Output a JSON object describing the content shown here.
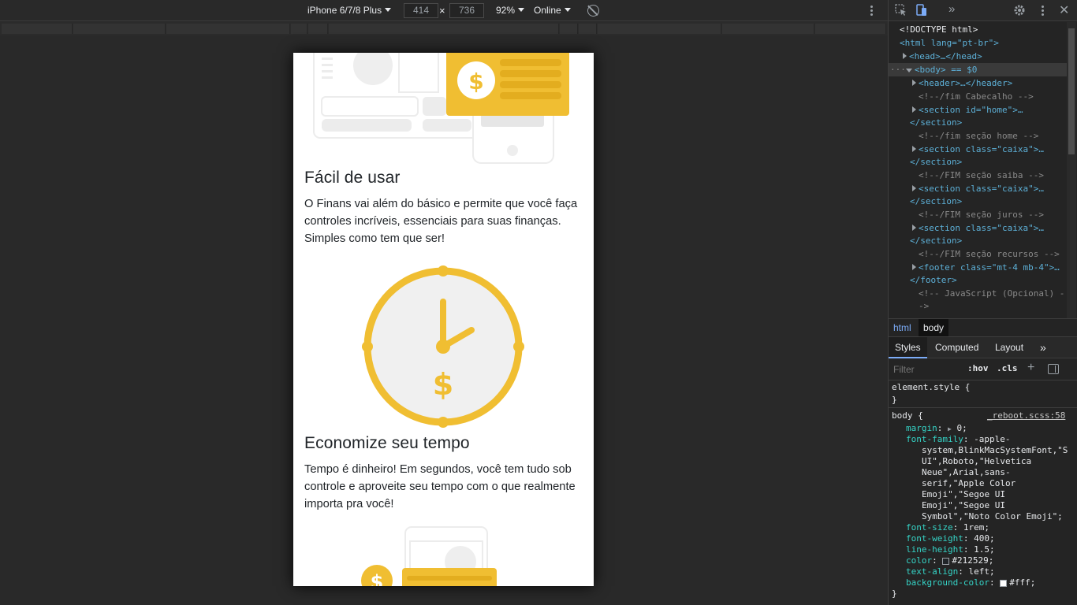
{
  "device_toolbar": {
    "device": "iPhone 6/7/8 Plus",
    "width": "414",
    "times": "×",
    "height": "736",
    "zoom": "92%",
    "throttle": "Online"
  },
  "page": {
    "section1": {
      "title": "Fácil de usar",
      "text": "O Finans vai além do básico e permite que você faça controles incríveis, essenciais para suas finanças. Simples como tem que ser!"
    },
    "section2": {
      "title": "Economize seu tempo",
      "text": "Tempo é dinheiro! Em segundos, você tem tudo sob controle e aproveite seu tempo com o que realmente importa pra você!"
    },
    "dollar_sign": "$"
  },
  "colors": {
    "accent_yellow": "#f0be32",
    "illustration_gray": "#ededed",
    "text_dark": "#212529"
  },
  "devtools": {
    "tree": [
      "<!DOCTYPE html>",
      "<html lang=\"pt-br\">",
      "<head>…</head>",
      "<body> == $0",
      "<header>…</header>",
      "<!--/fim Cabecalho -->",
      "<section id=\"home\">…",
      "</section>",
      "<!--/fim seção home -->",
      "<section class=\"caixa\">…",
      "</section>",
      "<!--/FIM seção saiba -->",
      "<section class=\"caixa\">…",
      "</section>",
      "<!--/FIM seção juros -->",
      "<section class=\"caixa\">…",
      "</section>",
      "<!--/FIM seção recursos -->",
      "<footer class=\"mt-4 mb-4\">…",
      "</footer>",
      "<!-- JavaScript (Opcional) -",
      "->"
    ],
    "breadcrumbs": [
      "html",
      "body"
    ],
    "tabs": [
      "Styles",
      "Computed",
      "Layout"
    ],
    "more_tabs": "»",
    "filter_placeholder": "Filter",
    "hov": ":hov",
    "cls": ".cls",
    "plus": "+",
    "element_style": "element.style {",
    "close_brace": "}",
    "body_rule": "body {",
    "source_link": "_reboot.scss:58",
    "props": [
      {
        "name": "margin",
        "value": "0;"
      },
      {
        "name": "font-family",
        "value": "-apple-"
      },
      {
        "name": "",
        "value": "system,BlinkMacSystemFont,\"S"
      },
      {
        "name": "",
        "value": "UI\",Roboto,\"Helvetica"
      },
      {
        "name": "",
        "value": "Neue\",Arial,sans-"
      },
      {
        "name": "",
        "value": "serif,\"Apple Color"
      },
      {
        "name": "",
        "value": "Emoji\",\"Segoe UI"
      },
      {
        "name": "",
        "value": "Emoji\",\"Segoe UI"
      },
      {
        "name": "",
        "value": "Symbol\",\"Noto Color Emoji\";"
      },
      {
        "name": "font-size",
        "value": "1rem;"
      },
      {
        "name": "font-weight",
        "value": "400;"
      },
      {
        "name": "line-height",
        "value": "1.5;"
      },
      {
        "name": "color",
        "value": "#212529;"
      },
      {
        "name": "text-align",
        "value": "left;"
      },
      {
        "name": "background-color",
        "value": "#fff;"
      }
    ]
  }
}
